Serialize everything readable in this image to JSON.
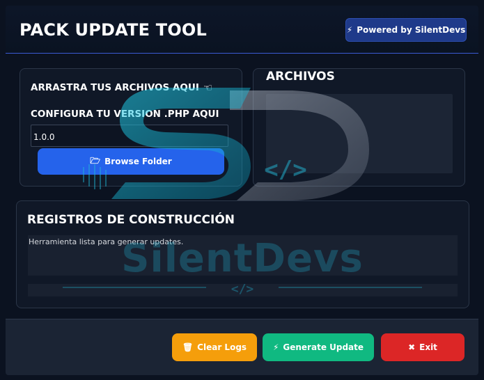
{
  "header": {
    "title": "PACK UPDATE TOOL",
    "powered_label": "Powered by SilentDevs"
  },
  "left_panel": {
    "drag_label": "ARRASTRA TUS ARCHIVOS AQUI",
    "config_label": "CONFIGURA TU VERSION .PHP AQUI",
    "version_value": "1.0.0",
    "browse_label": "Browse Folder"
  },
  "right_panel": {
    "title": "ARCHIVOS"
  },
  "logs": {
    "title": "REGISTROS DE CONSTRUCCIÓN",
    "message": "Herramienta lista para generar updates."
  },
  "footer": {
    "clear_label": "Clear Logs",
    "generate_label": "Generate Update",
    "exit_label": "Exit"
  },
  "watermark": {
    "brand": "SilentDevs",
    "code_symbol": "</>"
  },
  "colors": {
    "accent_blue": "#2563eb",
    "powered_bg": "#1f3a8a",
    "clear": "#f59e0b",
    "generate": "#10b981",
    "exit": "#dc2626",
    "brand_cyan": "#22b8d6"
  },
  "icons": {
    "powered": "bolt-icon",
    "drag": "pointing-hand-icon",
    "browse": "folder-open-icon",
    "clear": "trash-icon",
    "generate": "bolt-icon",
    "exit": "close-x-icon"
  }
}
